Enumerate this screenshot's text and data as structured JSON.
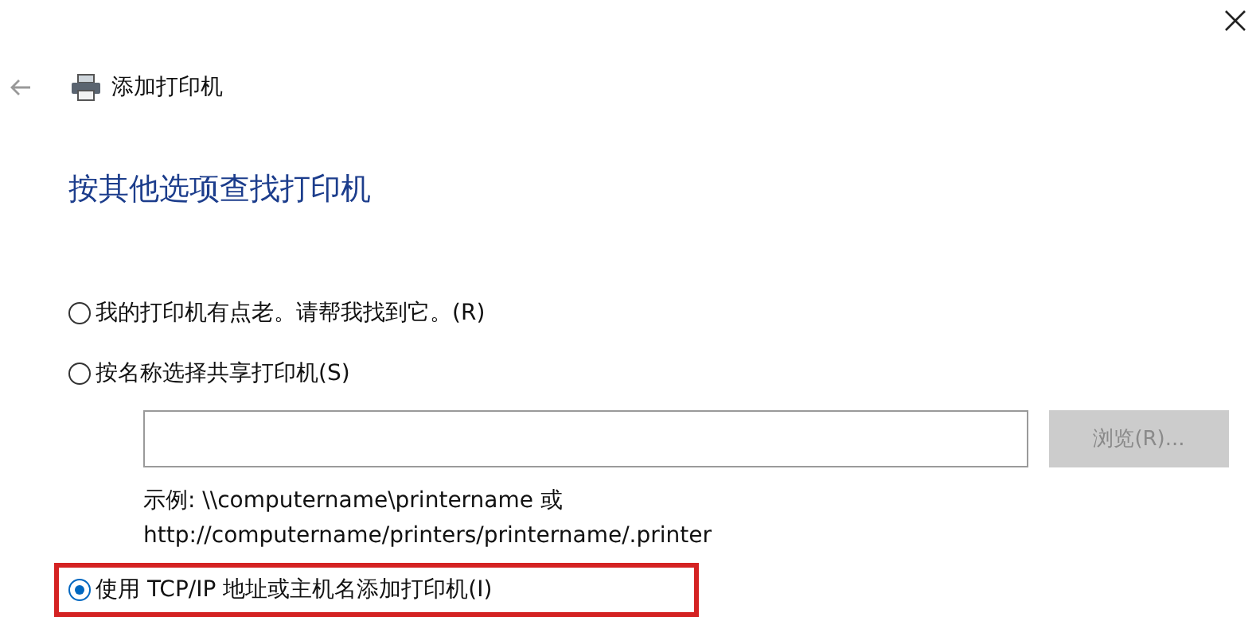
{
  "window": {
    "title": "添加打印机"
  },
  "heading": "按其他选项查找打印机",
  "options": [
    {
      "kind": "plain",
      "label": "我的打印机有点老。请帮我找到它。(R)",
      "selected": false
    },
    {
      "kind": "by_name",
      "label": "按名称选择共享打印机(S)",
      "selected": false,
      "browse_button": {
        "label": "浏览(R)...",
        "disabled": true
      },
      "example": [
        "示例: \\\\computername\\printername 或",
        "http://computername/printers/printername/.printer"
      ]
    },
    {
      "kind": "plain",
      "label": "使用 TCP/IP 地址或主机名添加打印机(I)",
      "selected": true,
      "highlighted": true
    }
  ]
}
